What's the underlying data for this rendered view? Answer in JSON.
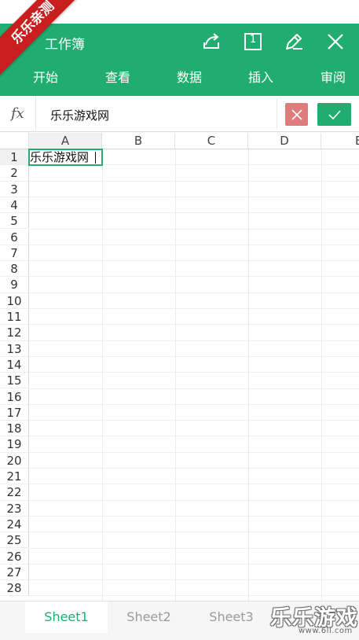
{
  "ribbon": {
    "text": "乐乐亲测"
  },
  "header": {
    "title": "工作簿",
    "tabs": [
      "开始",
      "查看",
      "数据",
      "插入",
      "审阅"
    ],
    "sheet_count_badge": "1",
    "icons": [
      "share-icon",
      "sheet-count-icon",
      "edit-icon",
      "close-icon"
    ]
  },
  "formula_bar": {
    "fx_label": "fx",
    "value": "乐乐游戏网"
  },
  "grid": {
    "columns": [
      "A",
      "B",
      "C",
      "D",
      "E"
    ],
    "rows": [
      "1",
      "2",
      "3",
      "4",
      "5",
      "6",
      "7",
      "8",
      "9",
      "10",
      "11",
      "12",
      "13",
      "14",
      "15",
      "16",
      "17",
      "18",
      "19",
      "20",
      "21",
      "22",
      "23",
      "24",
      "25",
      "26",
      "27",
      "28"
    ],
    "cells": {
      "A1": "乐乐游戏网"
    },
    "selected_cell": "A1"
  },
  "sheets": [
    "Sheet1",
    "Sheet2",
    "Sheet3"
  ],
  "active_sheet": "Sheet1",
  "watermark": {
    "text": "乐乐游戏",
    "url": "www.6ll.com"
  },
  "colors": {
    "accent": "#20ad6f",
    "cancel": "#de7b7b",
    "ribbon": "#c81e1e"
  }
}
